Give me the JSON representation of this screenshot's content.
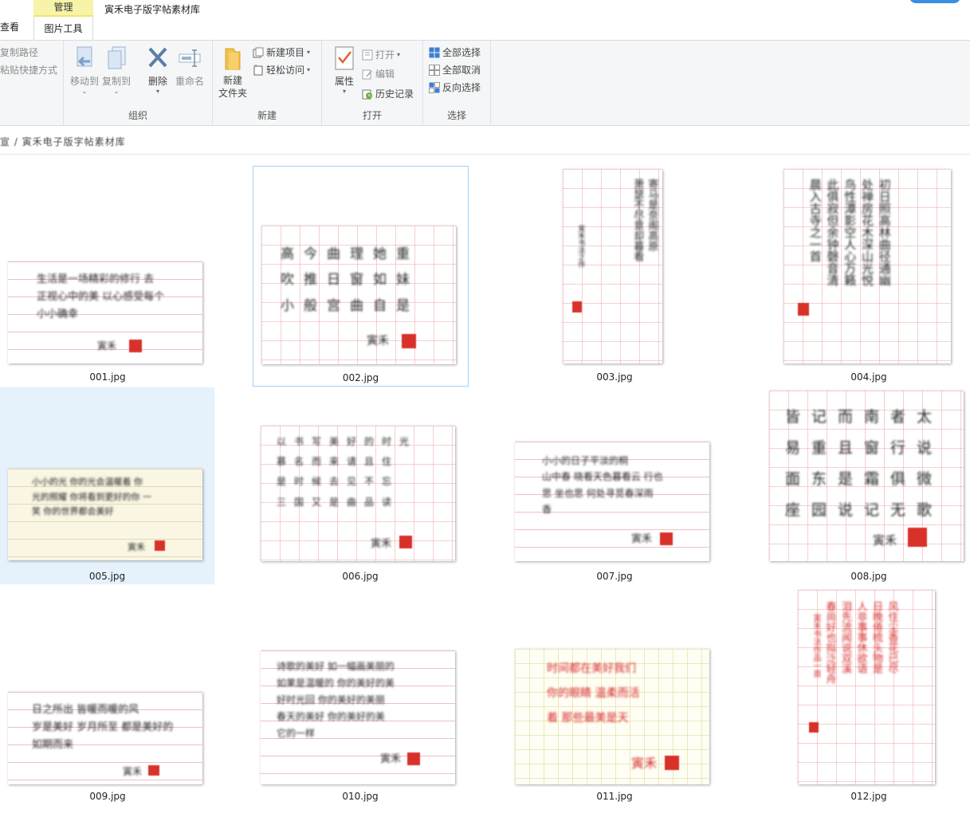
{
  "window": {
    "title": "寅禾电子版字帖素材库"
  },
  "tabs": {
    "view": "查看",
    "context_group": "管理",
    "context_tab": "图片工具"
  },
  "ribbon": {
    "clipboard": {
      "copy_path": "复制路径",
      "paste_shortcut": "粘贴快捷方式"
    },
    "organize": {
      "label": "组织",
      "move_to": "移动到",
      "copy_to": "复制到",
      "delete": "删除",
      "rename": "重命名"
    },
    "new": {
      "label": "新建",
      "new_folder": "新建\n文件夹",
      "new_item": "新建项目",
      "easy_access": "轻松访问"
    },
    "open": {
      "label": "打开",
      "properties": "属性",
      "open": "打开",
      "edit": "编辑",
      "history": "历史记录"
    },
    "select": {
      "label": "选择",
      "select_all": "全部选择",
      "select_none": "全部取消",
      "invert": "反向选择"
    }
  },
  "address": {
    "path": "宣 / 寅禾电子版字帖素材库"
  },
  "files": [
    {
      "name": "001.jpg"
    },
    {
      "name": "002.jpg"
    },
    {
      "name": "003.jpg"
    },
    {
      "name": "004.jpg"
    },
    {
      "name": "005.jpg"
    },
    {
      "name": "006.jpg"
    },
    {
      "name": "007.jpg"
    },
    {
      "name": "008.jpg"
    },
    {
      "name": "009.jpg"
    },
    {
      "name": "010.jpg"
    },
    {
      "name": "011.jpg"
    },
    {
      "name": "012.jpg"
    }
  ],
  "colors": {
    "accent": "#3a8ee6",
    "selection": "#e5f1fb",
    "focus_border": "#99d1ff",
    "context_tab": "#f7f3a8"
  }
}
